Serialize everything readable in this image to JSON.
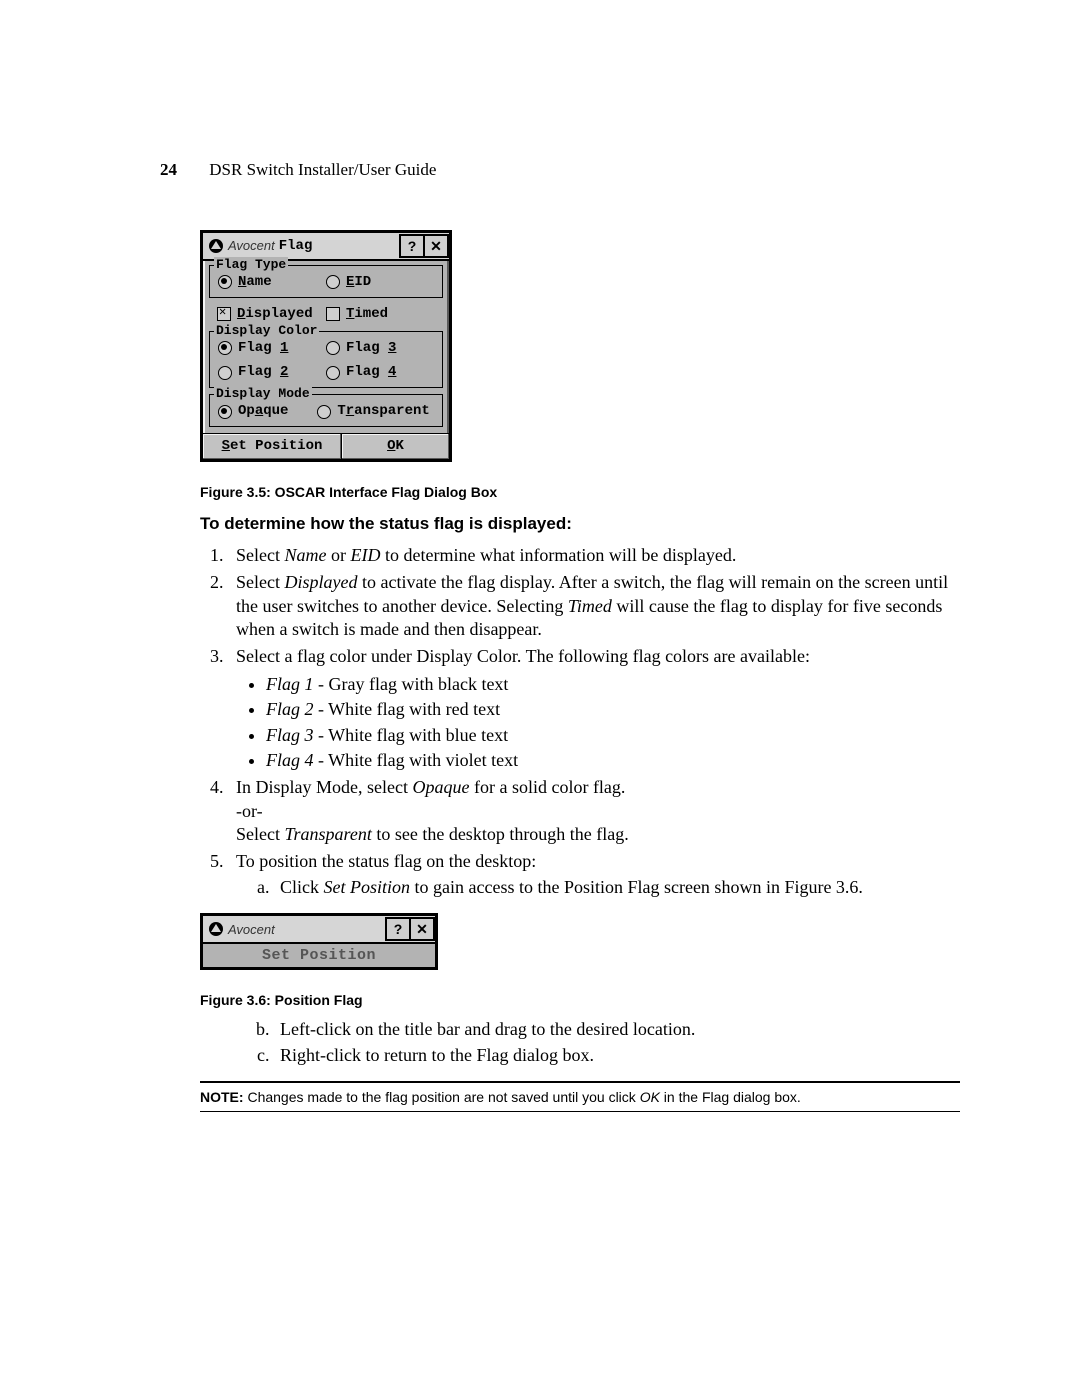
{
  "header": {
    "page_number": "24",
    "running_title": "DSR Switch Installer/User Guide"
  },
  "dialog1": {
    "brand": "Avocent",
    "title": "Flag",
    "help_btn": "?",
    "close_btn": "✕",
    "flag_type": {
      "legend": "Flag Type",
      "name_label": "Name",
      "name_underline": "N",
      "name_rest": "ame",
      "eid_label": "EID",
      "eid_underline": "E",
      "eid_rest": "ID"
    },
    "displayed": {
      "underline": "D",
      "rest": "isplayed"
    },
    "timed": {
      "underline": "T",
      "rest": "imed"
    },
    "display_color": {
      "legend": "Display Color",
      "flag1": {
        "pre": "Flag ",
        "u": "1"
      },
      "flag2": {
        "pre": "Flag ",
        "u": "2"
      },
      "flag3": {
        "pre": "Flag ",
        "u": "3"
      },
      "flag4": {
        "pre": "Flag ",
        "u": "4"
      }
    },
    "display_mode": {
      "legend": "Display Mode",
      "opaque": {
        "pre": "Op",
        "u": "a",
        "post": "que"
      },
      "transparent": {
        "pre": "T",
        "u": "r",
        "post": "ansparent"
      }
    },
    "buttons": {
      "set_position": {
        "u": "S",
        "rest": "et Position"
      },
      "ok_u": "O",
      "ok_rest": "K"
    }
  },
  "caption1": "Figure 3.5: OSCAR Interface Flag Dialog Box",
  "section_head": "To determine how the status flag is displayed:",
  "steps": {
    "s1a": "Select ",
    "s1b": "Name",
    "s1c": " or ",
    "s1d": "EID",
    "s1e": " to determine what information will be displayed.",
    "s2a": "Select ",
    "s2b": "Displayed",
    "s2c": " to activate the flag display. After a switch, the flag will remain on the screen until the user switches to another device. Selecting ",
    "s2d": "Timed",
    "s2e": " will cause the flag to display for five seconds when a switch is made and then disappear.",
    "s3": "Select a flag color under Display Color. The following flag colors are available:",
    "b1a": "Flag 1",
    "b1b": " - Gray flag with black text",
    "b2a": "Flag 2",
    "b2b": " - White flag with red text",
    "b3a": "Flag 3",
    "b3b": " - White flag with blue text",
    "b4a": "Flag 4",
    "b4b": " - White flag with violet text",
    "s4a": "In Display Mode, select ",
    "s4b": "Opaque",
    "s4c": " for a solid color flag.",
    "s4_or": "-or-",
    "s4d": "Select ",
    "s4e": "Transparent",
    "s4f": " to see the desktop through the flag.",
    "s5": "To position the status flag on the desktop:",
    "s5a_a": "Click ",
    "s5a_b": "Set Position",
    "s5a_c": " to gain access to the Position Flag screen shown in Figure 3.6."
  },
  "dialog2": {
    "brand": "Avocent",
    "help_btn": "?",
    "close_btn": "✕",
    "body": "Set Position"
  },
  "caption2": "Figure 3.6: Position Flag",
  "substeps": {
    "b": "Left-click on the title bar and drag to the desired location.",
    "c": "Right-click to return to the Flag dialog box."
  },
  "note": {
    "label": "NOTE:",
    "text_a": " Changes made to the flag position are not saved until you click ",
    "text_b": "OK",
    "text_c": " in the Flag dialog box."
  }
}
